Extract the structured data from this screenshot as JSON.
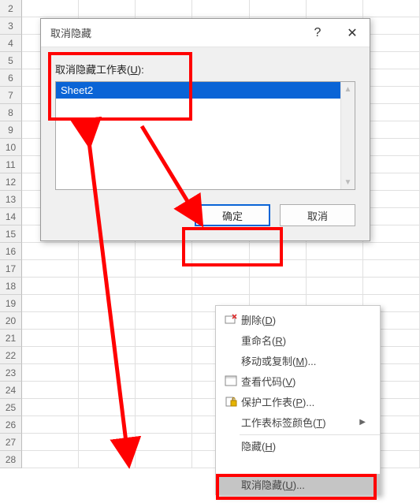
{
  "rows": [
    "2",
    "3",
    "4",
    "5",
    "6",
    "7",
    "8",
    "9",
    "10",
    "11",
    "12",
    "13",
    "14",
    "15",
    "16",
    "17",
    "18",
    "19",
    "20",
    "21",
    "22",
    "23",
    "24",
    "25",
    "26",
    "27",
    "28"
  ],
  "dialog": {
    "title": "取消隐藏",
    "help_symbol": "?",
    "close_symbol": "✕",
    "label_prefix": "取消隐藏工作表(",
    "label_key": "U",
    "label_suffix": "):",
    "items": [
      "Sheet2"
    ],
    "ok_label": "确定",
    "cancel_label": "取消"
  },
  "context_menu": {
    "delete": {
      "label": "删除(",
      "key": "D",
      "suffix": ")",
      "icon": "delete-icon"
    },
    "rename": {
      "label": "重命名(",
      "key": "R",
      "suffix": ")"
    },
    "move": {
      "label": "移动或复制(",
      "key": "M",
      "suffix": ")..."
    },
    "viewcode": {
      "label": "查看代码(",
      "key": "V",
      "suffix": ")",
      "icon": "code-icon"
    },
    "protect": {
      "label": "保护工作表(",
      "key": "P",
      "suffix": ")...",
      "icon": "lock-icon"
    },
    "tabcolor": {
      "label": "工作表标签颜色(",
      "key": "T",
      "suffix": ")",
      "submenu": "▶"
    },
    "hide": {
      "label": "隐藏(",
      "key": "H",
      "suffix": ")"
    },
    "unhide": {
      "label": "取消隐藏(",
      "key": "U",
      "suffix": ")..."
    }
  }
}
